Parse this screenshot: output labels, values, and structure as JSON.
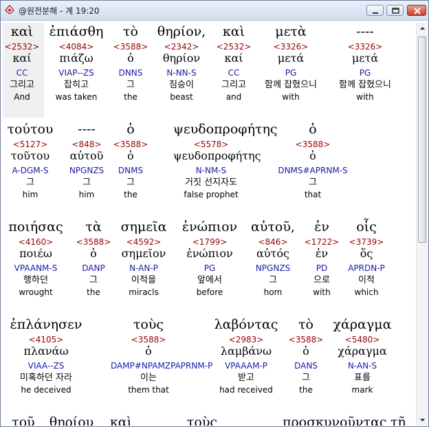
{
  "window": {
    "title": "@원전분해 - 계 19:20"
  },
  "verse_rows": [
    {
      "words": [
        {
          "greek": "καὶ",
          "num": "<2532>",
          "lex": "καί",
          "parse": "CC",
          "kor": "그리고",
          "eng": "And"
        },
        {
          "greek": "ἐπιάσθη",
          "num": "<4084>",
          "lex": "πιάζω",
          "parse": "VIAP--ZS",
          "kor": "잡히고",
          "eng": "was taken"
        },
        {
          "greek": "τὸ",
          "num": "<3588>",
          "lex": "ὁ",
          "parse": "DNNS",
          "kor": "그",
          "eng": "the"
        },
        {
          "greek": "θηρίον,",
          "num": "<2342>",
          "lex": "θηρίον",
          "parse": "N-NN-S",
          "kor": "짐승이",
          "eng": "beast"
        },
        {
          "greek": "καὶ",
          "num": "<2532>",
          "lex": "καί",
          "parse": "CC",
          "kor": "그리고",
          "eng": "and"
        },
        {
          "greek": "μετὰ",
          "num": "<3326>",
          "lex": "μετά",
          "parse": "PG",
          "kor": "함께 잡혔으니",
          "eng": "with"
        },
        {
          "greek": "----",
          "num": "<3326>",
          "lex": "μετά",
          "parse": "PG",
          "kor": "함께 잡혔으니",
          "eng": "with"
        }
      ]
    },
    {
      "words": [
        {
          "greek": "τούτου",
          "num": "<5127>",
          "lex": "τοῦτου",
          "parse": "A-DGM-S",
          "kor": "그",
          "eng": "him"
        },
        {
          "greek": "----",
          "num": "<848>",
          "lex": "αὐτοῦ",
          "parse": "NPGNZS",
          "kor": "그",
          "eng": "him"
        },
        {
          "greek": "ὁ",
          "num": "<3588>",
          "lex": "ὁ",
          "parse": "DNMS",
          "kor": "그",
          "eng": "the"
        },
        {
          "greek": "ψευδοπροφήτης",
          "num": "<5578>",
          "lex": "ψευδοπροφήτης",
          "parse": "N-NM-S",
          "kor": "거짓 선지자도",
          "eng": "false prophet"
        },
        {
          "greek": "ὁ",
          "num": "<3588>",
          "lex": "ὁ",
          "parse": "DNMS#APRNM-S",
          "kor": "그",
          "eng": "that"
        }
      ]
    },
    {
      "words": [
        {
          "greek": "ποιήσας",
          "num": "<4160>",
          "lex": "ποιέω",
          "parse": "VPAANM-S",
          "kor": "행하던",
          "eng": "wrought"
        },
        {
          "greek": "τὰ",
          "num": "<3588>",
          "lex": "ὁ",
          "parse": "DANP",
          "kor": "그",
          "eng": "the"
        },
        {
          "greek": "σημεῖα",
          "num": "<4592>",
          "lex": "σημεῖον",
          "parse": "N-AN-P",
          "kor": "이적을",
          "eng": "miracls"
        },
        {
          "greek": "ἐνώπιον",
          "num": "<1799>",
          "lex": "ἐνώπιον",
          "parse": "PG",
          "kor": "앞에서",
          "eng": "before"
        },
        {
          "greek": "αὐτοῦ,",
          "num": "<846>",
          "lex": "αὐτός",
          "parse": "NPGNZS",
          "kor": "그",
          "eng": "hom"
        },
        {
          "greek": "ἐν",
          "num": "<1722>",
          "lex": "ἐν",
          "parse": "PD",
          "kor": "으로",
          "eng": "with"
        },
        {
          "greek": "οἷς",
          "num": "<3739>",
          "lex": "ὅς",
          "parse": "APRDN-P",
          "kor": "이적",
          "eng": "which"
        }
      ]
    },
    {
      "words": [
        {
          "greek": "ἐπλάνησεν",
          "num": "<4105>",
          "lex": "πλανάω",
          "parse": "VIAA--ZS",
          "kor": "미혹하던 자라",
          "eng": "he deceived"
        },
        {
          "greek": "τοὺς",
          "num": "<3588>",
          "lex": "ὁ",
          "parse": "DAMP#NPAMZPAPRNM-P",
          "kor": "이는",
          "eng": "them that"
        },
        {
          "greek": "λαβόντας",
          "num": "<2983>",
          "lex": "λαμβάνω",
          "parse": "VPAAAM-P",
          "kor": "받고",
          "eng": "had received"
        },
        {
          "greek": "τὸ",
          "num": "<3588>",
          "lex": "ὁ",
          "parse": "DANS",
          "kor": "그",
          "eng": "the"
        },
        {
          "greek": "χάραγμα",
          "num": "<5480>",
          "lex": "χάραγμα",
          "parse": "N-AN-S",
          "kor": "표를",
          "eng": "mark"
        }
      ]
    },
    {
      "words": [
        {
          "greek": "τοῦ"
        },
        {
          "greek": "θηρίου"
        },
        {
          "greek": "καὶ"
        },
        {
          "greek": "τοὺς"
        },
        {
          "greek": "προσκυνοῦντας"
        },
        {
          "greek": "τῇ"
        }
      ]
    }
  ]
}
